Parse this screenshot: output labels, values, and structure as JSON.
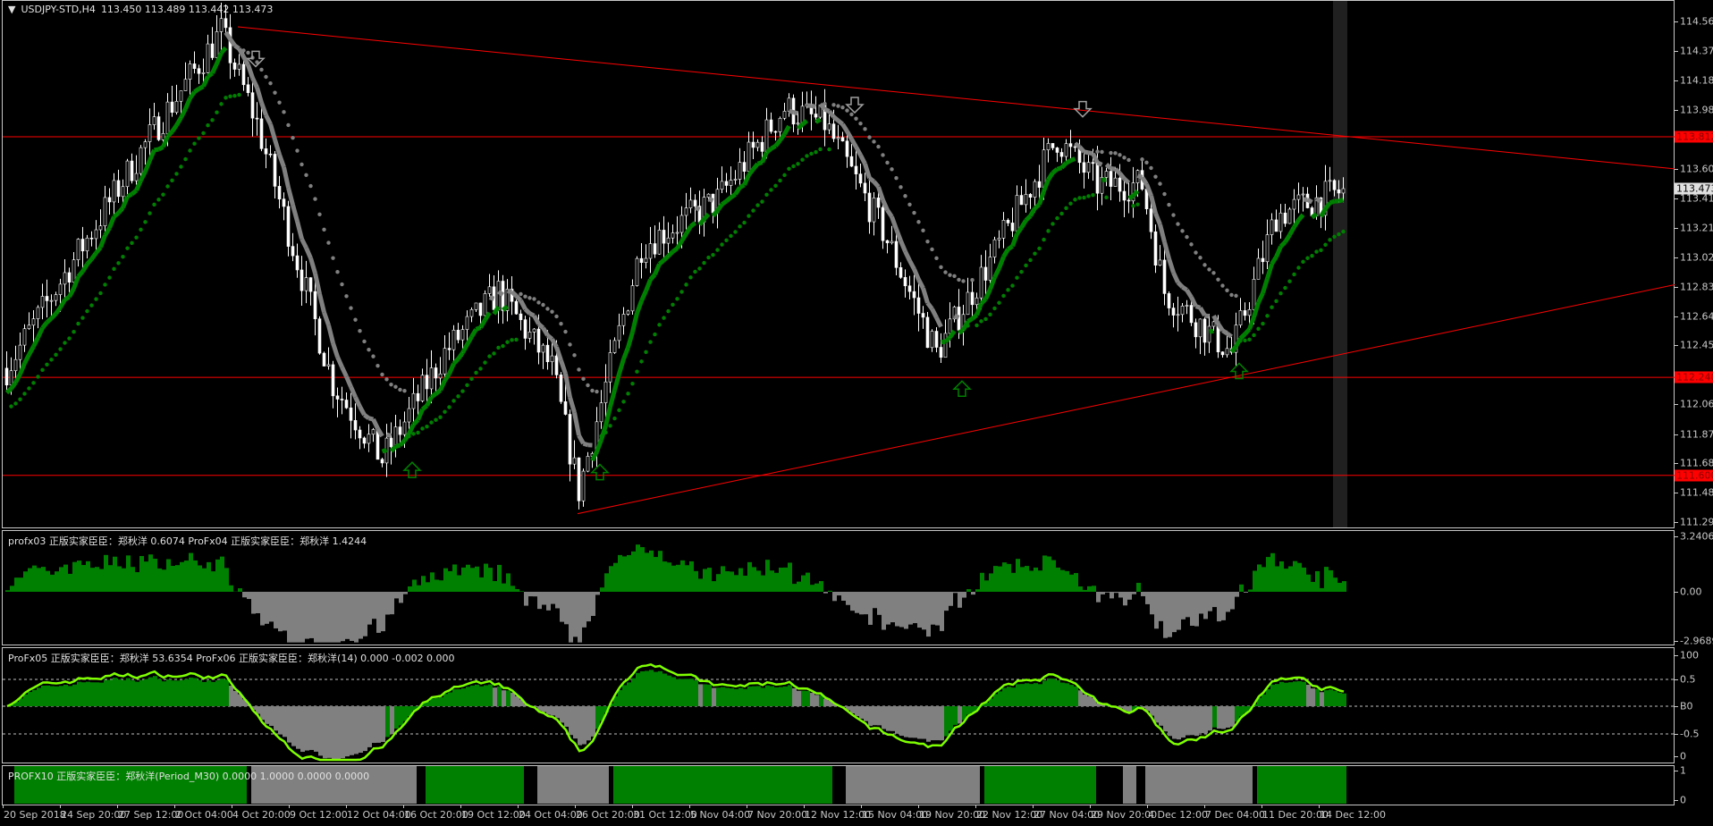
{
  "header": {
    "symbol": "USDJPY-STD,H4",
    "ohlc": "113.450 113.489 113.442 113.473",
    "menu_icon": "triangle-down-icon"
  },
  "price_axis": {
    "labels": [
      "114.565",
      "114.370",
      "114.180",
      "113.985",
      "113.795",
      "113.600",
      "113.410",
      "113.215",
      "113.025",
      "112.830",
      "112.640",
      "112.450",
      "112.065",
      "111.870",
      "111.680",
      "111.485",
      "111.295"
    ],
    "current_price": "113.473",
    "hlines": [
      "113.812",
      "112.240",
      "111.600"
    ]
  },
  "sub1": {
    "label": "profx03  正版实家臣臣：郑秋洋 0.6074   ProFx04  正版实家臣臣：郑秋洋 1.4244",
    "axis": [
      "3.2406",
      "0.00",
      "-2.9689"
    ]
  },
  "sub2": {
    "label": "ProFx05  正版实家臣臣：郑秋洋 53.6354   ProFx06  正版实家臣臣：郑秋洋(14) 0.000 -0.002 0.000",
    "axis": [
      "100",
      "0.5",
      "B0",
      "-0.5",
      "0"
    ]
  },
  "sub3": {
    "label": "PROFX10  正版实家臣臣：郑秋洋(Period_M30) 0.0000 1.0000 0.0000 0.0000",
    "axis": [
      "1",
      "0"
    ]
  },
  "time_axis": [
    "20 Sep 2018",
    "24 Sep 20:00",
    "27 Sep 12:00",
    "2 Oct 04:00",
    "4 Oct 20:00",
    "9 Oct 12:00",
    "12 Oct 04:00",
    "16 Oct 20:00",
    "19 Oct 12:00",
    "24 Oct 04:00",
    "26 Oct 20:00",
    "31 Oct 12:00",
    "5 Nov 04:00",
    "7 Nov 20:00",
    "12 Nov 12:00",
    "15 Nov 04:00",
    "19 Nov 20:00",
    "22 Nov 12:00",
    "27 Nov 04:00",
    "29 Nov 20:00",
    "4 Dec 12:00",
    "7 Dec 04:00",
    "11 Dec 20:00",
    "14 Dec 12:00"
  ],
  "colors": {
    "bull": "#008000",
    "bear": "#808080",
    "candle": "#ffffff",
    "line": "#ff0000",
    "osc": "#7fff00",
    "band": "#202020"
  },
  "chart_data": {
    "type": "candlestick",
    "price_range": [
      111.295,
      114.565
    ],
    "path_keypoints": [
      [
        0,
        112.3
      ],
      [
        34,
        113.9
      ],
      [
        48,
        114.5
      ],
      [
        56,
        113.9
      ],
      [
        73,
        112.2
      ],
      [
        84,
        111.7
      ],
      [
        98,
        112.4
      ],
      [
        110,
        112.8
      ],
      [
        122,
        112.3
      ],
      [
        128,
        111.5
      ],
      [
        142,
        113.1
      ],
      [
        159,
        113.4
      ],
      [
        174,
        114.0
      ],
      [
        183,
        113.9
      ],
      [
        196,
        113.2
      ],
      [
        208,
        112.4
      ],
      [
        220,
        113.0
      ],
      [
        235,
        113.8
      ],
      [
        244,
        113.5
      ],
      [
        254,
        113.5
      ],
      [
        259,
        112.8
      ],
      [
        274,
        112.4
      ],
      [
        284,
        113.3
      ],
      [
        298,
        113.45
      ]
    ],
    "signals_down": [
      56,
      190,
      241
    ],
    "signals_up": [
      91,
      133,
      214,
      276
    ],
    "trendlines": [
      [
        [
          52,
          114.53
        ],
        [
          374,
          113.6
        ]
      ],
      [
        [
          128,
          111.35
        ],
        [
          374,
          112.85
        ]
      ]
    ]
  }
}
